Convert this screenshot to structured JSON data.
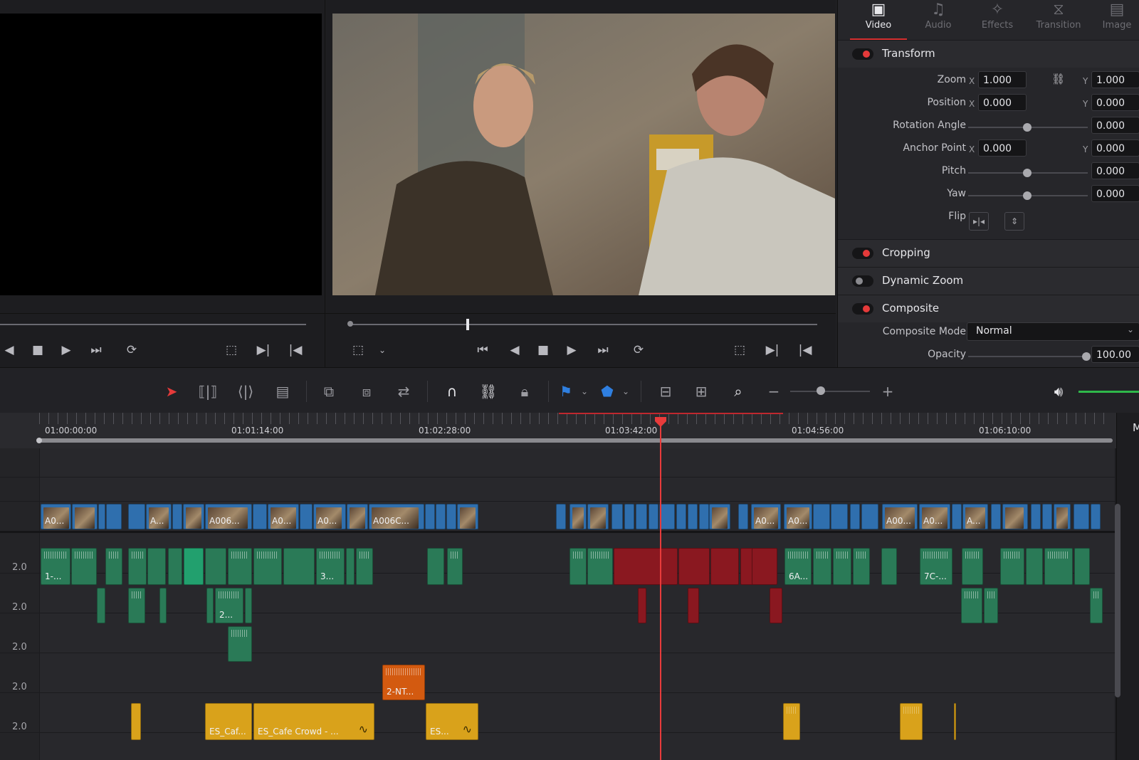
{
  "inspector": {
    "tabs": [
      {
        "label": "Video",
        "icon": "video-icon",
        "active": true
      },
      {
        "label": "Audio",
        "icon": "music-note-icon",
        "active": false
      },
      {
        "label": "Effects",
        "icon": "effects-icon",
        "active": false
      },
      {
        "label": "Transition",
        "icon": "transition-icon",
        "active": false
      },
      {
        "label": "Image",
        "icon": "image-icon",
        "active": false
      }
    ],
    "transform": {
      "title": "Transform",
      "zoom_label": "Zoom",
      "zoom_x": "1.000",
      "zoom_y": "1.000",
      "position_label": "Position",
      "position_x": "0.000",
      "position_y": "0.000",
      "rotation_label": "Rotation Angle",
      "rotation_value": "0.000",
      "anchor_label": "Anchor Point",
      "anchor_x": "0.000",
      "anchor_y": "0.000",
      "pitch_label": "Pitch",
      "pitch_value": "0.000",
      "yaw_label": "Yaw",
      "yaw_value": "0.000",
      "flip_label": "Flip",
      "axis_x": "X",
      "axis_y": "Y"
    },
    "cropping": {
      "title": "Cropping"
    },
    "dynamic_zoom": {
      "title": "Dynamic Zoom"
    },
    "composite": {
      "title": "Composite",
      "mode_label": "Composite Mode",
      "mode_value": "Normal",
      "opacity_label": "Opacity",
      "opacity_value": "100.00"
    }
  },
  "ruler": {
    "timecodes": [
      "01:00:00:00",
      "01:01:14:00",
      "01:02:28:00",
      "01:03:42:00",
      "01:04:56:00",
      "01:06:10:00"
    ],
    "right_edge_label": "M"
  },
  "tracks": {
    "audio_levels": [
      "2.0",
      "2.0",
      "2.0",
      "2.0",
      "2.0"
    ],
    "video_labels": [
      "A0...",
      "A...",
      "A006...",
      "A0...",
      "A0...",
      "A006C...",
      "A0...",
      "A0...",
      "A00...",
      "A0...",
      "A..."
    ],
    "audio1_labels": [
      "1-...",
      "3...",
      "6A...",
      "7C-..."
    ],
    "audio2_labels": [
      "2..."
    ],
    "audio4_labels": [
      "2-NT..."
    ],
    "audio5_labels": [
      "ES_Caf...",
      "ES_Cafe Crowd - ...",
      "ES..."
    ]
  },
  "colors": {
    "accent": "#e53a3a",
    "video_clip": "#2f6fae",
    "audio_clip": "#2a7a57",
    "selected_audio": "#8a1820",
    "orange_clip": "#d35a10",
    "yellow_clip": "#d9a21b"
  }
}
